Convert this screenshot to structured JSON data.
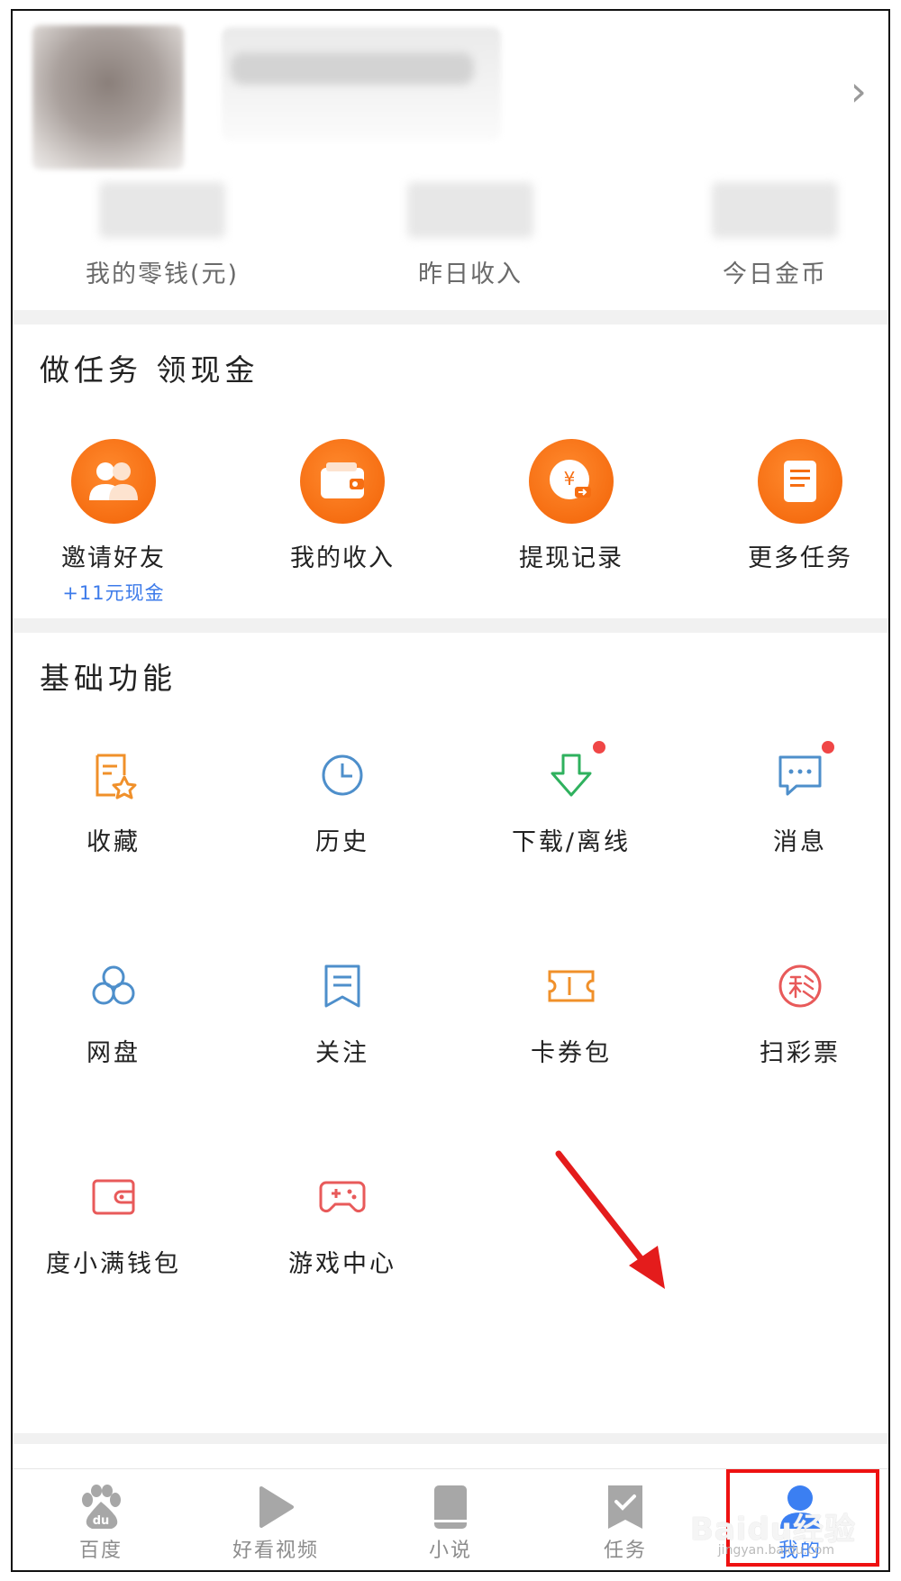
{
  "header": {
    "chevron": "›"
  },
  "stats": [
    {
      "label": "我的零钱(元)"
    },
    {
      "label": "昨日收入"
    },
    {
      "label": "今日金币"
    }
  ],
  "tasks_section": {
    "title": "做任务  领现金",
    "items": [
      {
        "label": "邀请好友",
        "sub": "+11元现金",
        "icon": "friends-icon"
      },
      {
        "label": "我的收入",
        "icon": "wallet-icon"
      },
      {
        "label": "提现记录",
        "icon": "withdraw-icon"
      },
      {
        "label": "更多任务",
        "icon": "document-icon"
      }
    ]
  },
  "basic_section": {
    "title": "基础功能",
    "items": [
      {
        "label": "收藏",
        "icon": "favorite-icon",
        "color": "#f0902a"
      },
      {
        "label": "历史",
        "icon": "clock-icon",
        "color": "#4e8fcb"
      },
      {
        "label": "下载/离线",
        "icon": "download-icon",
        "color": "#2fb15e",
        "badge": true
      },
      {
        "label": "消息",
        "icon": "message-icon",
        "color": "#4e8fcb",
        "badge": true
      },
      {
        "label": "网盘",
        "icon": "netdisk-icon",
        "color": "#4e8fcb"
      },
      {
        "label": "关注",
        "icon": "follow-icon",
        "color": "#4e8fcb"
      },
      {
        "label": "卡券包",
        "icon": "ticket-icon",
        "color": "#f0902a"
      },
      {
        "label": "扫彩票",
        "icon": "lottery-icon",
        "color": "#e85a5a"
      },
      {
        "label": "度小满钱包",
        "icon": "purse-icon",
        "color": "#e85a5a"
      },
      {
        "label": "游戏中心",
        "icon": "gamepad-icon",
        "color": "#e85a5a"
      }
    ]
  },
  "bottom_nav": {
    "items": [
      {
        "label": "百度",
        "icon": "baidu-paw-icon"
      },
      {
        "label": "好看视频",
        "icon": "play-icon"
      },
      {
        "label": "小说",
        "icon": "book-icon"
      },
      {
        "label": "任务",
        "icon": "task-icon"
      },
      {
        "label": "我的",
        "icon": "user-icon",
        "active": true
      }
    ],
    "active_color": "#3b7ff2",
    "inactive_color": "#8c8c8c"
  },
  "watermark": {
    "text": "Baidu经验",
    "sub": "jingyan.baidu.com"
  }
}
